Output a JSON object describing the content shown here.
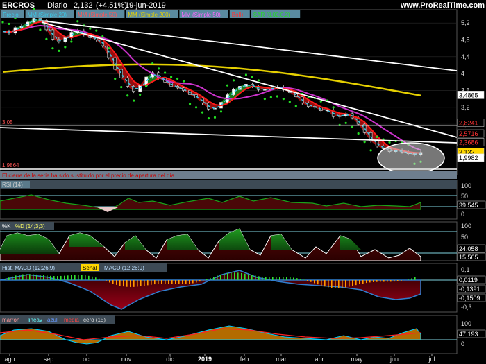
{
  "header": {
    "symbol": "ERCROS",
    "period": "Diario",
    "price": "2,132",
    "change": "(+4,51%)",
    "date": "19-jun-2019",
    "site": "www.ProRealTime.com"
  },
  "colors": {
    "bg": "#000000",
    "grid": "#2a2a2a",
    "axis_text": "#dddddd",
    "up": "#1f8f1f",
    "down": "#b01010",
    "ma20": "#ff1a1a",
    "ma50": "#cc33cc",
    "ma200": "#e6d000",
    "sar": "#22dd22",
    "boll": "#3cc8e6",
    "trend": "#ffffff",
    "hline": "#7fd3e0"
  },
  "chart_data": [
    {
      "type": "line",
      "panel": "price",
      "legend": [
        "Precio",
        "MM (Simple 20)",
        "MM (Simple 50)",
        "MM (Simple 200)",
        "MM (Simple 50)",
        "Boll+",
        "SAR (0,02;0,2)"
      ],
      "yticks": [
        "5,2",
        "4,8",
        "4,4",
        "4",
        "3,6",
        "3,2",
        "2,8",
        "2,4"
      ],
      "ylim": [
        1.7,
        5.45
      ],
      "price_labels": [
        "3,4865",
        "2,8241",
        "2,5716",
        "2,3686",
        "2,132",
        "1,9982"
      ],
      "annotations": [
        "3,05",
        "1,9864"
      ],
      "notice": "El cierre de la serie ha sido sustituido por el precio de apertura del día",
      "close": [
        5.0,
        4.96,
        5.09,
        5.13,
        5.22,
        5.31,
        5.26,
        5.04,
        4.82,
        4.76,
        4.85,
        4.98,
        5.02,
        4.92,
        4.85,
        4.8,
        4.66,
        4.38,
        4.1,
        3.9,
        3.7,
        3.58,
        3.72,
        3.92,
        4.02,
        3.9,
        3.8,
        3.7,
        3.66,
        3.6,
        3.5,
        3.42,
        3.3,
        3.16,
        3.18,
        3.32,
        3.5,
        3.62,
        3.7,
        3.75,
        3.7,
        3.62,
        3.62,
        3.66,
        3.68,
        3.62,
        3.55,
        3.45,
        3.3,
        3.22,
        3.2,
        3.12,
        3.14,
        2.98,
        3.0,
        3.05,
        2.95,
        2.8,
        2.6,
        2.4,
        2.28,
        2.22,
        2.15,
        2.18,
        2.14,
        2.1,
        2.08,
        2.13
      ]
    },
    {
      "type": "line",
      "panel": "rsi",
      "legend": [
        "RSI (14)"
      ],
      "yticks": [
        "100",
        "50",
        "0"
      ],
      "value_label": "39,545"
    },
    {
      "type": "line",
      "panel": "stochastic",
      "legend": [
        "%K",
        "%D (14;3;3)"
      ],
      "yticks": [
        "100",
        "50",
        "0"
      ],
      "value_labels": [
        "24,058",
        "15,565"
      ]
    },
    {
      "type": "bar",
      "panel": "macd",
      "legend": [
        "Hist. MACD (12;26;9)",
        "Señal",
        "MACD (12;26;9)"
      ],
      "yticks": [
        "0,1",
        "-0,1",
        "-0,2",
        "-0,3"
      ],
      "value_labels": [
        "0,0119",
        "-0,1391",
        "-0,1509"
      ]
    },
    {
      "type": "area",
      "panel": "momentum",
      "legend": [
        "marron",
        "lineav",
        "azul",
        "media",
        "cero (15)"
      ],
      "yticks": [
        "100",
        "50",
        "0"
      ],
      "value_labels": [
        "47,193",
        "0"
      ]
    }
  ],
  "xaxis": [
    "ago",
    "sep",
    "oct",
    "nov",
    "dic",
    "2019",
    "feb",
    "mar",
    "abr",
    "may",
    "jun",
    "jul"
  ]
}
